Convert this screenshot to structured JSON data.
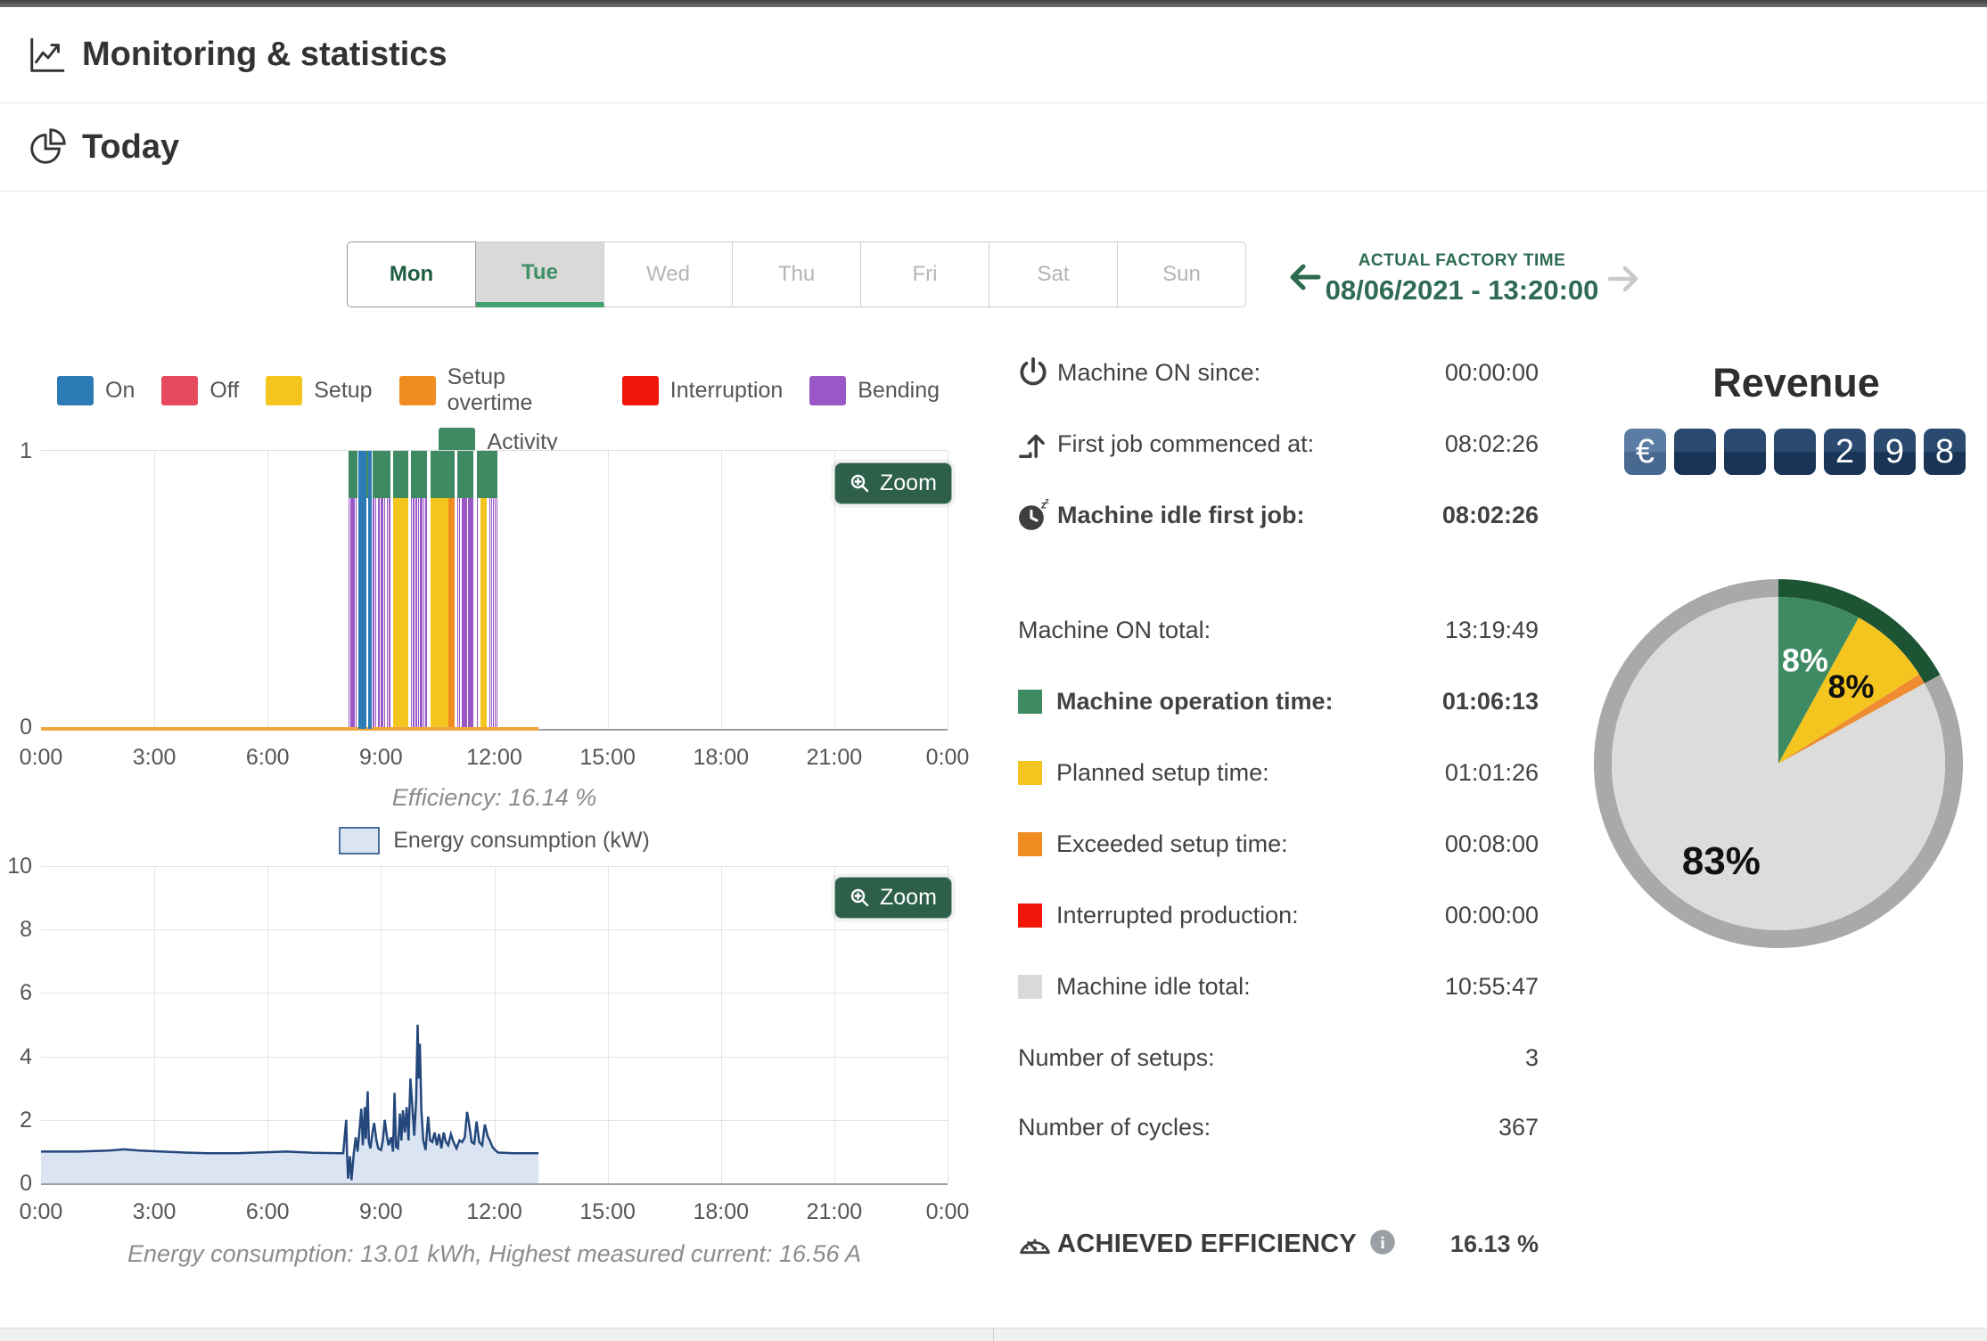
{
  "header": {
    "title": "Monitoring & statistics"
  },
  "section": {
    "title": "Today"
  },
  "tabs": {
    "days": [
      {
        "label": "Mon",
        "state": "today"
      },
      {
        "label": "Tue",
        "state": "active"
      },
      {
        "label": "Wed",
        "state": "disabled"
      },
      {
        "label": "Thu",
        "state": "disabled"
      },
      {
        "label": "Fri",
        "state": "disabled"
      },
      {
        "label": "Sat",
        "state": "disabled"
      },
      {
        "label": "Sun",
        "state": "disabled"
      }
    ]
  },
  "factory_time": {
    "label": "ACTUAL FACTORY TIME",
    "value": "08/06/2021 - 13:20:00"
  },
  "colors": {
    "states": {
      "on": "#2d7bb6",
      "off": "#e54a5e",
      "setup": "#f4c51e",
      "setup_overtime": "#ef8d20",
      "interruption": "#f2150a",
      "bending": "#9a57c6",
      "activity": "#3e8a62",
      "idle": "#d9d9d9"
    },
    "accent_green": "#2d5f4a",
    "baseline_orange": "#efa73d",
    "energy_line": "#24477c",
    "energy_fill": "#dbe4f2"
  },
  "chart_data": [
    {
      "id": "machine-state-timeline",
      "type": "bar",
      "zoom_label": "Zoom",
      "caption": "Efficiency: 16.14 %",
      "x_ticks": [
        "0:00",
        "3:00",
        "6:00",
        "9:00",
        "12:00",
        "15:00",
        "18:00",
        "21:00",
        "0:00"
      ],
      "y_ticks": [
        "1",
        "0"
      ],
      "x_range_hours": [
        0,
        24
      ],
      "legend_row1": [
        {
          "label": "On",
          "state": "on"
        },
        {
          "label": "Off",
          "state": "off"
        },
        {
          "label": "Setup",
          "state": "setup"
        },
        {
          "label": "Setup overtime",
          "state": "setup_overtime"
        },
        {
          "label": "Interruption",
          "state": "interruption"
        },
        {
          "label": "Bending",
          "state": "bending"
        }
      ],
      "legend_row2": [
        {
          "label": "Activity",
          "state": "activity"
        }
      ],
      "bar_height_fraction": 0.83,
      "baseline": {
        "from": 0,
        "to": 13.17
      },
      "state_segments": [
        [
          8.13,
          8.16,
          "bending"
        ],
        [
          8.18,
          8.2,
          "bending"
        ],
        [
          8.22,
          8.25,
          "bending"
        ],
        [
          8.27,
          8.3,
          "bending"
        ],
        [
          8.32,
          8.35,
          "bending"
        ],
        [
          8.4,
          8.62,
          "on"
        ],
        [
          8.66,
          8.75,
          "on"
        ],
        [
          8.79,
          8.82,
          "bending"
        ],
        [
          8.85,
          8.88,
          "bending"
        ],
        [
          8.91,
          8.96,
          "bending"
        ],
        [
          8.98,
          9.06,
          "bending"
        ],
        [
          9.09,
          9.12,
          "bending"
        ],
        [
          9.15,
          9.18,
          "bending"
        ],
        [
          9.21,
          9.26,
          "bending"
        ],
        [
          9.32,
          9.73,
          "setup"
        ],
        [
          9.79,
          9.82,
          "bending"
        ],
        [
          9.85,
          9.88,
          "bending"
        ],
        [
          9.91,
          9.95,
          "bending"
        ],
        [
          9.98,
          10.01,
          "bending"
        ],
        [
          10.04,
          10.09,
          "bending"
        ],
        [
          10.12,
          10.15,
          "bending"
        ],
        [
          10.18,
          10.23,
          "bending"
        ],
        [
          10.31,
          10.79,
          "setup"
        ],
        [
          10.79,
          10.96,
          "setup_overtime"
        ],
        [
          11.01,
          11.03,
          "bending"
        ],
        [
          11.06,
          11.08,
          "bending"
        ],
        [
          11.13,
          11.29,
          "bending"
        ],
        [
          11.31,
          11.45,
          "bending"
        ],
        [
          11.53,
          11.57,
          "bending"
        ],
        [
          11.63,
          11.81,
          "setup"
        ],
        [
          11.86,
          11.88,
          "bending"
        ],
        [
          11.91,
          11.93,
          "bending"
        ],
        [
          11.96,
          11.98,
          "bending"
        ],
        [
          12.01,
          12.03,
          "bending"
        ],
        [
          12.06,
          12.08,
          "bending"
        ]
      ],
      "activity_segments": [
        [
          8.13,
          8.38
        ],
        [
          8.4,
          8.75
        ],
        [
          8.79,
          9.26
        ],
        [
          9.32,
          9.73
        ],
        [
          9.79,
          10.23
        ],
        [
          10.31,
          10.96
        ],
        [
          11.01,
          11.45
        ],
        [
          11.53,
          12.08
        ]
      ]
    },
    {
      "id": "energy-consumption",
      "type": "area",
      "legend_label": "Energy consumption (kW)",
      "zoom_label": "Zoom",
      "caption": "Energy consumption: 13.01 kWh, Highest measured current: 16.56 A",
      "ylabel": "kW",
      "ylim": [
        0,
        10
      ],
      "y_ticks": [
        0,
        2,
        4,
        6,
        8,
        10
      ],
      "x_ticks": [
        "0:00",
        "3:00",
        "6:00",
        "9:00",
        "12:00",
        "15:00",
        "18:00",
        "21:00",
        "0:00"
      ],
      "x_range_hours": [
        0,
        24
      ],
      "points": [
        [
          0,
          1.0
        ],
        [
          1,
          1.0
        ],
        [
          1.8,
          1.03
        ],
        [
          2.2,
          1.07
        ],
        [
          2.6,
          1.03
        ],
        [
          3.2,
          1.0
        ],
        [
          3.8,
          0.97
        ],
        [
          4.4,
          0.95
        ],
        [
          5.2,
          0.95
        ],
        [
          6.0,
          0.98
        ],
        [
          6.5,
          1.0
        ],
        [
          7.2,
          0.96
        ],
        [
          7.9,
          0.95
        ],
        [
          8.0,
          0.95
        ],
        [
          8.05,
          1.6
        ],
        [
          8.08,
          2.0
        ],
        [
          8.1,
          1.0
        ],
        [
          8.13,
          0.15
        ],
        [
          8.18,
          0.85
        ],
        [
          8.22,
          0.1
        ],
        [
          8.28,
          0.95
        ],
        [
          8.33,
          1.45
        ],
        [
          8.38,
          1.0
        ],
        [
          8.43,
          1.65
        ],
        [
          8.48,
          2.35
        ],
        [
          8.52,
          1.2
        ],
        [
          8.57,
          2.4
        ],
        [
          8.6,
          1.4
        ],
        [
          8.65,
          2.9
        ],
        [
          8.68,
          1.3
        ],
        [
          8.72,
          1.1
        ],
        [
          8.78,
          1.65
        ],
        [
          8.82,
          1.9
        ],
        [
          8.88,
          1.35
        ],
        [
          8.93,
          1.1
        ],
        [
          9.0,
          1.05
        ],
        [
          9.05,
          1.35
        ],
        [
          9.1,
          2.0
        ],
        [
          9.15,
          1.55
        ],
        [
          9.2,
          1.2
        ],
        [
          9.27,
          1.45
        ],
        [
          9.32,
          1.0
        ],
        [
          9.36,
          2.85
        ],
        [
          9.4,
          1.15
        ],
        [
          9.45,
          1.1
        ],
        [
          9.5,
          2.2
        ],
        [
          9.54,
          1.35
        ],
        [
          9.58,
          2.3
        ],
        [
          9.63,
          1.6
        ],
        [
          9.68,
          2.4
        ],
        [
          9.73,
          1.35
        ],
        [
          9.78,
          3.3
        ],
        [
          9.83,
          2.45
        ],
        [
          9.88,
          1.5
        ],
        [
          9.93,
          2.6
        ],
        [
          9.97,
          5.0
        ],
        [
          10.0,
          3.3
        ],
        [
          10.03,
          4.4
        ],
        [
          10.07,
          2.3
        ],
        [
          10.12,
          1.35
        ],
        [
          10.18,
          1.05
        ],
        [
          10.25,
          2.1
        ],
        [
          10.3,
          1.35
        ],
        [
          10.36,
          1.3
        ],
        [
          10.42,
          1.6
        ],
        [
          10.48,
          1.2
        ],
        [
          10.54,
          1.55
        ],
        [
          10.6,
          1.1
        ],
        [
          10.66,
          1.6
        ],
        [
          10.72,
          1.3
        ],
        [
          10.78,
          1.2
        ],
        [
          10.85,
          1.55
        ],
        [
          10.92,
          1.3
        ],
        [
          11.0,
          1.1
        ],
        [
          11.08,
          1.35
        ],
        [
          11.15,
          1.3
        ],
        [
          11.22,
          1.45
        ],
        [
          11.28,
          2.25
        ],
        [
          11.33,
          1.9
        ],
        [
          11.4,
          1.3
        ],
        [
          11.47,
          1.25
        ],
        [
          11.53,
          1.95
        ],
        [
          11.6,
          1.3
        ],
        [
          11.68,
          1.2
        ],
        [
          11.75,
          1.85
        ],
        [
          11.82,
          1.5
        ],
        [
          11.88,
          1.35
        ],
        [
          11.95,
          1.15
        ],
        [
          12.02,
          1.05
        ],
        [
          12.1,
          0.97
        ],
        [
          12.5,
          0.95
        ],
        [
          13.0,
          0.95
        ],
        [
          13.17,
          0.95
        ]
      ]
    },
    {
      "id": "time-distribution-pie",
      "type": "pie",
      "slices": [
        {
          "label": "8%",
          "value": 8,
          "color": "#3e8a62",
          "label_color": "#ffffff",
          "label_size": 36,
          "label_radius": 120
        },
        {
          "label": "8%",
          "value": 8,
          "color": "#f4c51e",
          "label_color": "#111111",
          "label_size": 36,
          "label_radius": 119
        },
        {
          "label": "",
          "value": 1,
          "color": "#ef8b31",
          "label_color": "#111111",
          "label_size": 0,
          "label_radius": 0
        },
        {
          "label": "83%",
          "value": 83,
          "color": "#dcdcdc",
          "label_color": "#111111",
          "label_size": 44,
          "label_radius": 126
        }
      ],
      "ring": {
        "highlight_fraction": 0.17,
        "highlight_color": "#1c5434",
        "base_color": "#a9a9a9"
      }
    }
  ],
  "stats": {
    "rows": [
      {
        "icon": "power-icon",
        "label": "Machine ON since:",
        "value": "00:00:00",
        "bold": false
      },
      {
        "icon": "first-job-icon",
        "label": "First job commenced at:",
        "value": "08:02:26",
        "bold": false
      },
      {
        "icon": "idle-clock-icon",
        "label": "Machine idle first job:",
        "value": "08:02:26",
        "bold": true
      },
      {
        "icon": null,
        "chip": null,
        "label": "Machine ON total:",
        "value": "13:19:49",
        "bold": false
      },
      {
        "icon": null,
        "chip": "activity",
        "label": "Machine operation time:",
        "value": "01:06:13",
        "bold": true
      },
      {
        "icon": null,
        "chip": "setup",
        "label": "Planned setup time:",
        "value": "01:01:26",
        "bold": false
      },
      {
        "icon": null,
        "chip": "setup_overtime",
        "label": "Exceeded setup time:",
        "value": "00:08:00",
        "bold": false
      },
      {
        "icon": null,
        "chip": "interruption",
        "label": "Interrupted production:",
        "value": "00:00:00",
        "bold": false
      },
      {
        "icon": null,
        "chip": "idle",
        "label": "Machine idle total:",
        "value": "10:55:47",
        "bold": false
      },
      {
        "icon": null,
        "chip": null,
        "label": "Number of setups:",
        "value": "3",
        "bold": false
      },
      {
        "icon": null,
        "chip": null,
        "label": "Number of cycles:",
        "value": "367",
        "bold": false
      }
    ],
    "efficiency": {
      "icon": "gauge-icon",
      "label": "ACHIEVED EFFICIENCY",
      "info_icon": "info-icon",
      "value": "16.13 %"
    }
  },
  "revenue": {
    "title": "Revenue",
    "currency": "€",
    "digits": [
      "",
      "",
      "",
      "2",
      "9",
      "8"
    ]
  }
}
